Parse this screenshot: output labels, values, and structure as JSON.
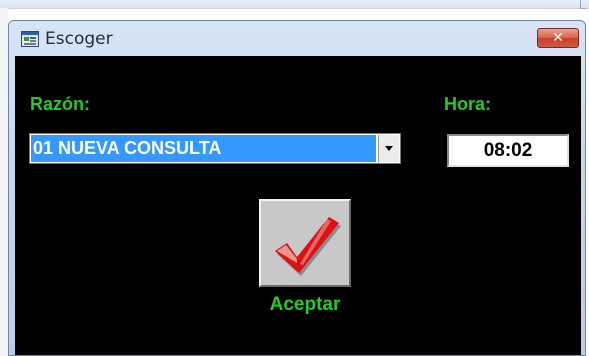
{
  "window": {
    "title": "Escoger",
    "close_glyph": "✕",
    "icon": "app-window-icon"
  },
  "form": {
    "reason_label": "Razón:",
    "reason_selected": "01 NUEVA CONSULTA",
    "time_label": "Hora:",
    "time_value": "08:02"
  },
  "actions": {
    "accept_label": "Aceptar",
    "accept_icon": "checkmark-icon"
  },
  "colors": {
    "client_background": "#000000",
    "label_green": "#22cc22",
    "selection_blue": "#3399ff",
    "checkmark_red": "#dd1111",
    "close_button_red": "#c4412b"
  }
}
